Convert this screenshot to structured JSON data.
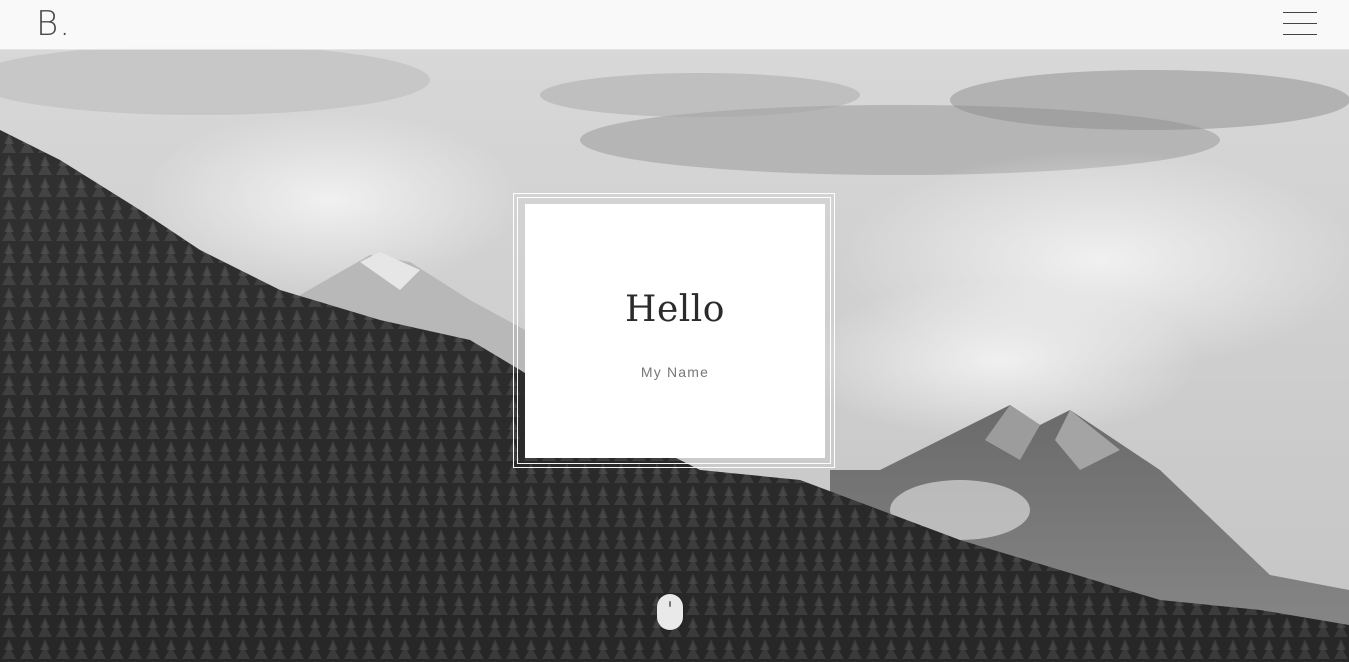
{
  "header": {
    "logo_text": "B.",
    "menu_icon": "hamburger-icon"
  },
  "hero": {
    "background": "grayscale mountain forest landscape",
    "title": "Hello",
    "subtitle": "My Name",
    "scroll_icon": "mouse-scroll-icon"
  },
  "colors": {
    "card_bg": "#ffffff",
    "title_color": "#2b2b2b",
    "subtitle_color": "#777777",
    "header_bg": "#fafafa"
  }
}
